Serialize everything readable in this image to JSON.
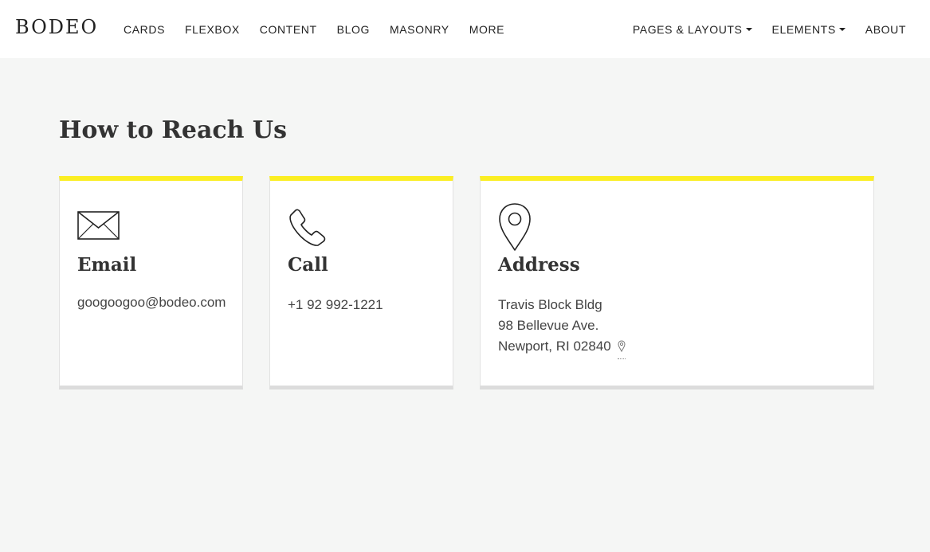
{
  "brand": "BODEO",
  "nav": {
    "left": [
      "CARDS",
      "FLEXBOX",
      "CONTENT",
      "BLOG",
      "MASONRY",
      "MORE"
    ],
    "right": [
      {
        "label": "PAGES & LAYOUTS",
        "dropdown": true
      },
      {
        "label": "ELEMENTS",
        "dropdown": true
      },
      {
        "label": "ABOUT",
        "dropdown": false
      }
    ]
  },
  "page": {
    "title": "How to Reach Us"
  },
  "cards": {
    "email": {
      "icon": "envelope-icon",
      "heading": "Email",
      "text": "googoogoo@bodeo.com"
    },
    "call": {
      "icon": "phone-icon",
      "heading": "Call",
      "text": "+1 92 992-1221"
    },
    "address": {
      "icon": "map-pin-icon",
      "heading": "Address",
      "lines": [
        "Travis Block Bldg",
        "98 Bellevue Ave.",
        "Newport, RI 02840"
      ]
    }
  },
  "colors": {
    "accent": "#fbee23",
    "background": "#f5f6f5",
    "card": "#ffffff"
  }
}
